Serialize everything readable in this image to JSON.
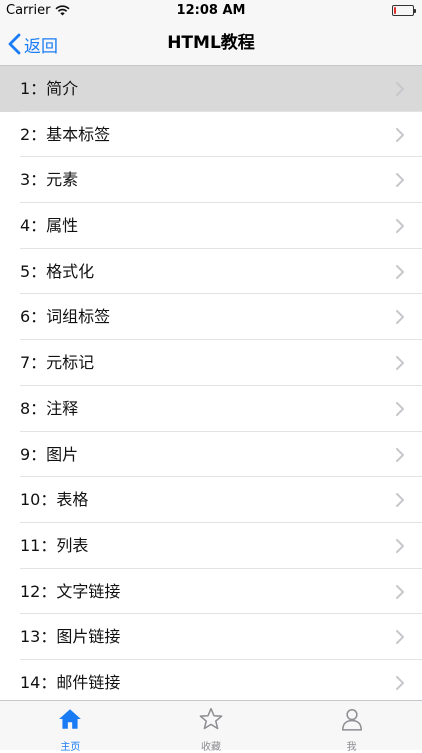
{
  "status": {
    "carrier": "Carrier",
    "time": "12:08 AM",
    "battery_level": 0.1
  },
  "nav": {
    "back_label": "返回",
    "title": "HTML教程"
  },
  "list": {
    "items": [
      {
        "label": "1：简介",
        "selected": true
      },
      {
        "label": "2：基本标签"
      },
      {
        "label": "3：元素"
      },
      {
        "label": "4：属性"
      },
      {
        "label": "5：格式化"
      },
      {
        "label": "6：词组标签"
      },
      {
        "label": "7：元标记"
      },
      {
        "label": "8：注释"
      },
      {
        "label": "9：图片"
      },
      {
        "label": "10：表格"
      },
      {
        "label": "11：列表"
      },
      {
        "label": "12：文字链接"
      },
      {
        "label": "13：图片链接"
      },
      {
        "label": "14：邮件链接"
      }
    ]
  },
  "tabs": [
    {
      "label": "主页",
      "icon": "home-icon",
      "active": true
    },
    {
      "label": "收藏",
      "icon": "star-icon"
    },
    {
      "label": "我",
      "icon": "person-icon"
    }
  ],
  "colors": {
    "accent": "#1a7cf5",
    "selected_row": "#d9d9d9",
    "battery_low": "#e0302a",
    "inactive": "#8e8e93"
  }
}
